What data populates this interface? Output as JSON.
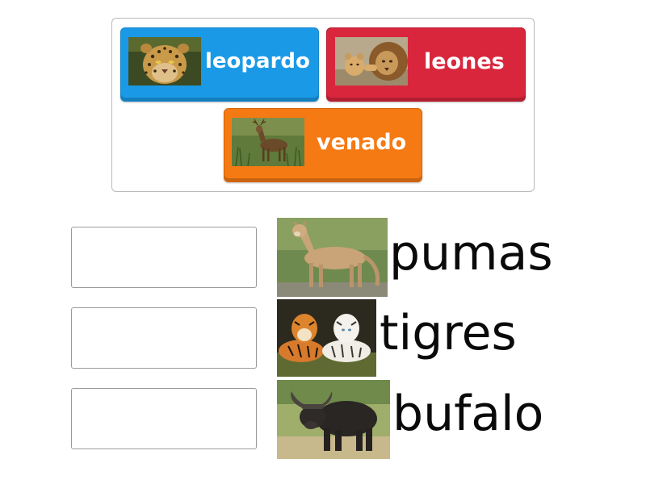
{
  "tiles": [
    {
      "label": "leopardo",
      "color": "#1a9ae6",
      "image": "leopard-photo"
    },
    {
      "label": "leones",
      "color": "#d9263c",
      "image": "lions-photo"
    },
    {
      "label": "venado",
      "color": "#f57a13",
      "image": "deer-photo"
    }
  ],
  "prompts": [
    {
      "text": "pumas",
      "image": "puma-photo"
    },
    {
      "text": "tigres",
      "image": "tigers-photo"
    },
    {
      "text": "bufalo",
      "image": "buffalo-photo"
    }
  ]
}
